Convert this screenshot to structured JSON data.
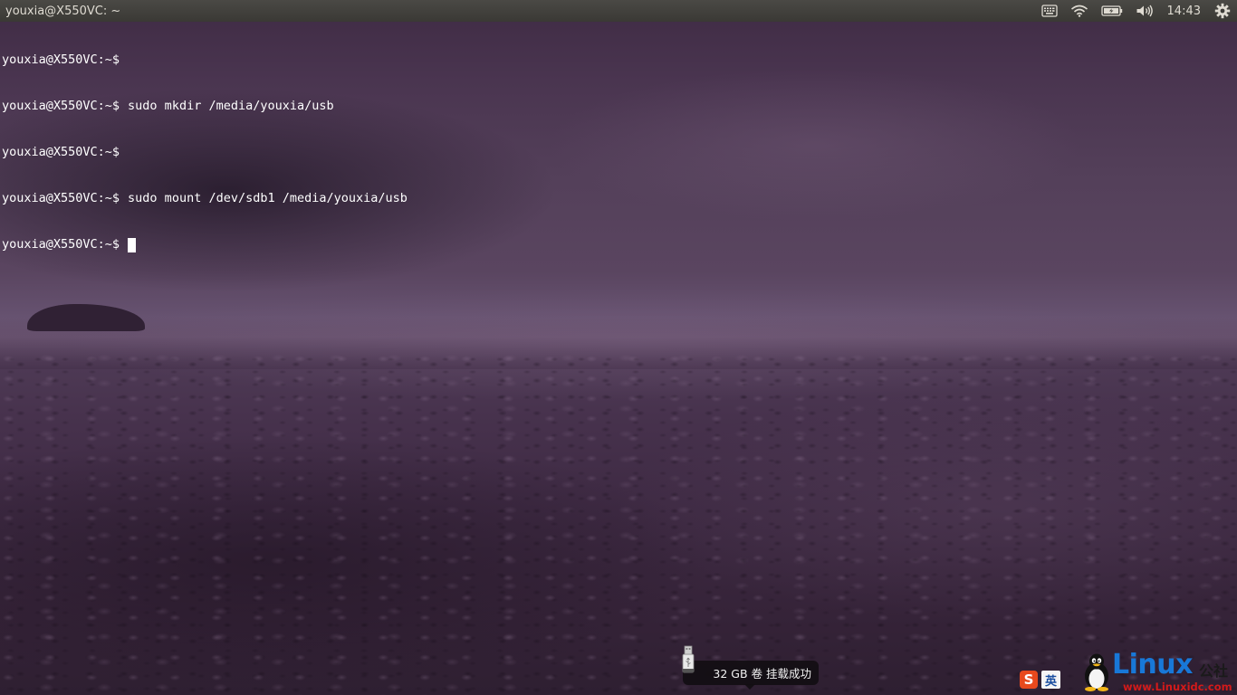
{
  "panel": {
    "window_title": "youxia@X550VC: ~",
    "clock": "14:43",
    "indicators": [
      "keyboard-icon",
      "wifi-icon",
      "battery-icon",
      "volume-icon",
      "gear-icon"
    ]
  },
  "terminal": {
    "prompt": "youxia@X550VC:~$",
    "lines": [
      {
        "command": ""
      },
      {
        "command": "sudo mkdir /media/youxia/usb"
      },
      {
        "command": ""
      },
      {
        "command": "sudo mount /dev/sdb1 /media/youxia/usb"
      },
      {
        "command": ""
      }
    ]
  },
  "notification": {
    "icon": "usb-drive-icon",
    "text": "32 GB 卷 挂载成功"
  },
  "input_method": {
    "logo_letter": "S",
    "mode": "英"
  },
  "watermark": {
    "title": "Linux",
    "suffix": "公社",
    "url": "www.Linuxidc.com"
  },
  "colors": {
    "panel_bg": "#3c3b37",
    "terminal_text": "#ffffff",
    "watermark_blue": "#1878d8",
    "watermark_red": "#d31a1a",
    "ime_orange": "#e8491d"
  }
}
